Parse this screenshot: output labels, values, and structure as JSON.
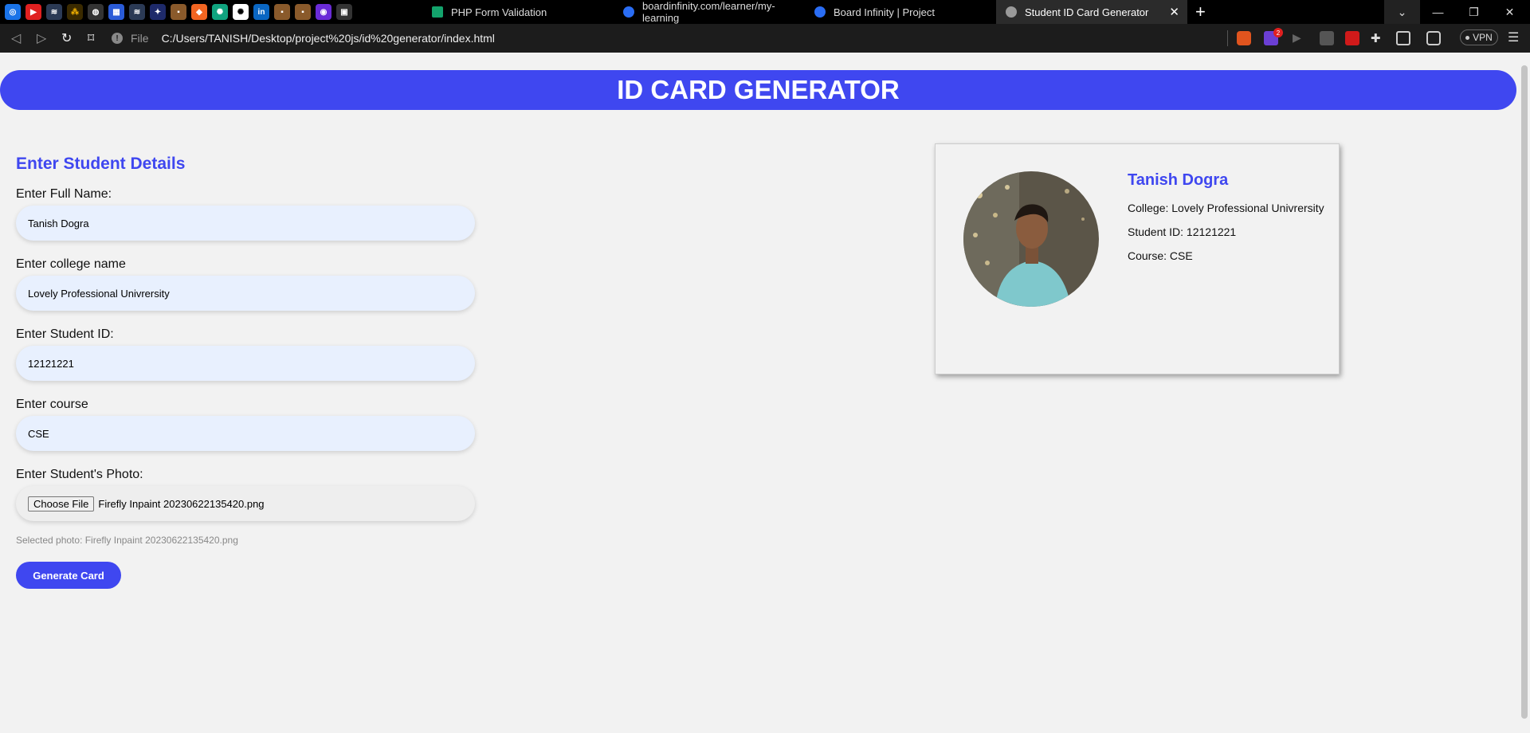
{
  "browser": {
    "tabs": [
      {
        "title": "PHP Form Validation"
      },
      {
        "title": "boardinfinity.com/learner/my-learning"
      },
      {
        "title": "Board Infinity | Project"
      },
      {
        "title": "Student ID Card Generator"
      }
    ],
    "url_scheme": "File",
    "url": "C:/Users/TANISH/Desktop/project%20js/id%20generator/index.html",
    "vpn_label": "VPN",
    "notification_badge": "2"
  },
  "page": {
    "header_title": "ID CARD GENERATOR",
    "form_heading": "Enter Student Details",
    "fields": [
      {
        "label": "Enter Full Name:",
        "value": "Tanish Dogra"
      },
      {
        "label": "Enter college name",
        "value": "Lovely Professional Univrersity"
      },
      {
        "label": "Enter Student ID:",
        "value": "12121221"
      },
      {
        "label": "Enter course",
        "value": "CSE"
      }
    ],
    "photo_field": {
      "label": "Enter Student's Photo:",
      "button_label": "Choose File",
      "filename": "Firefly Inpaint 20230622135420.png"
    },
    "selected_photo_note": "Selected photo: Firefly Inpaint 20230622135420.png",
    "generate_button": "Generate Card"
  },
  "card": {
    "name": "Tanish Dogra",
    "college_line": "College: Lovely Professional Univrersity",
    "id_line": "Student ID: 12121221",
    "course_line": "Course: CSE"
  },
  "colors": {
    "accent": "#3f47f0",
    "input_bg": "#e8f0fe",
    "page_bg": "#f2f2f2"
  }
}
